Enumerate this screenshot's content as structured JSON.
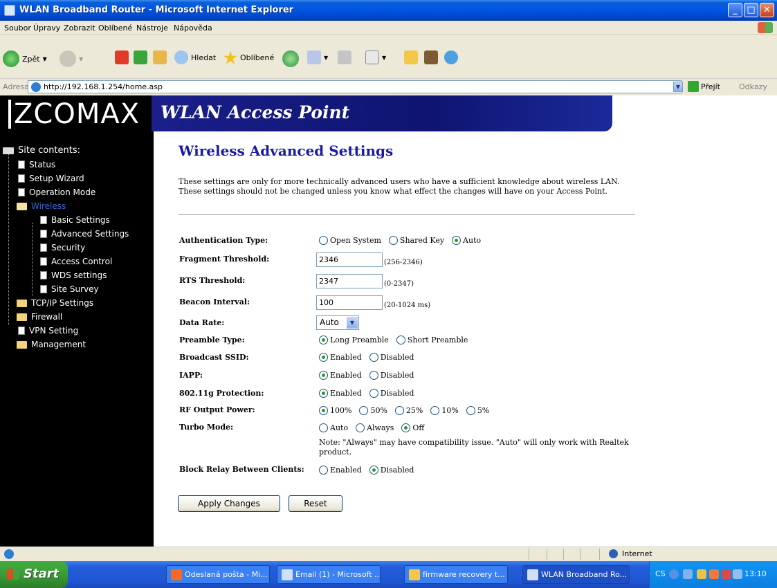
{
  "window": {
    "title": "WLAN Broadband Router - Microsoft Internet Explorer"
  },
  "menu": [
    "Soubor",
    "Úpravy",
    "Zobrazit",
    "Oblíbené",
    "Nástroje",
    "Nápověda"
  ],
  "toolbar": {
    "back": "Zpět",
    "search": "Hledat",
    "favorites": "Oblíbené"
  },
  "address": {
    "label": "Adresa",
    "url": "http://192.168.1.254/home.asp",
    "go": "Přejít",
    "links": "Odkazy"
  },
  "banner": {
    "logo": "ZCOMAX",
    "product": "WLAN Access Point"
  },
  "sidebar": {
    "title": "Site contents:",
    "items": [
      {
        "label": "Status"
      },
      {
        "label": "Setup Wizard"
      },
      {
        "label": "Operation Mode"
      },
      {
        "label": "Wireless"
      },
      {
        "label": "Basic Settings"
      },
      {
        "label": "Advanced Settings"
      },
      {
        "label": "Security"
      },
      {
        "label": "Access Control"
      },
      {
        "label": "WDS settings"
      },
      {
        "label": "Site Survey"
      },
      {
        "label": "TCP/IP Settings"
      },
      {
        "label": "Firewall"
      },
      {
        "label": "VPN Setting"
      },
      {
        "label": "Management"
      }
    ]
  },
  "page": {
    "title": "Wireless Advanced Settings",
    "description": "These settings are only for more technically advanced users who have a sufficient knowledge about wireless LAN. These settings should not be changed unless you know what effect the changes will have on your Access Point."
  },
  "form": {
    "auth": {
      "label": "Authentication Type:",
      "options": [
        "Open System",
        "Shared Key",
        "Auto"
      ],
      "selected": "Auto"
    },
    "fragment": {
      "label": "Fragment Threshold:",
      "value": "2346",
      "range": "(256-2346)"
    },
    "rts": {
      "label": "RTS Threshold:",
      "value": "2347",
      "range": "(0-2347)"
    },
    "beacon": {
      "label": "Beacon Interval:",
      "value": "100",
      "range": "(20-1024 ms)"
    },
    "datarate": {
      "label": "Data Rate:",
      "value": "Auto"
    },
    "preamble": {
      "label": "Preamble Type:",
      "options": [
        "Long Preamble",
        "Short Preamble"
      ],
      "selected": "Long Preamble"
    },
    "ssid": {
      "label": "Broadcast SSID:",
      "options": [
        "Enabled",
        "Disabled"
      ],
      "selected": "Enabled"
    },
    "iapp": {
      "label": "IAPP:",
      "options": [
        "Enabled",
        "Disabled"
      ],
      "selected": "Enabled"
    },
    "protection": {
      "label": "802.11g Protection:",
      "options": [
        "Enabled",
        "Disabled"
      ],
      "selected": "Enabled"
    },
    "rfpower": {
      "label": "RF Output Power:",
      "options": [
        "100%",
        "50%",
        "25%",
        "10%",
        "5%"
      ],
      "selected": "100%"
    },
    "turbo": {
      "label": "Turbo Mode:",
      "options": [
        "Auto",
        "Always",
        "Off"
      ],
      "selected": "Off",
      "note": "Note: \"Always\" may have compatibility issue. \"Auto\" will only work with Realtek product."
    },
    "relay": {
      "label": "Block Relay Between Clients:",
      "options": [
        "Enabled",
        "Disabled"
      ],
      "selected": "Disabled"
    },
    "apply": "Apply Changes",
    "reset": "Reset"
  },
  "statusbar": {
    "zone": "Internet"
  },
  "taskbar": {
    "start": "Start",
    "tasks": [
      "Odeslaná pošta - Mi...",
      "Email (1) - Microsoft ...",
      "firmware recovery t...",
      "WLAN Broadband Ro..."
    ],
    "lang": "CS",
    "clock": "13:10"
  },
  "colors": {
    "link": "#1a1aa6",
    "active_nav": "#3c66d9",
    "radio_dot": "#21a121"
  }
}
